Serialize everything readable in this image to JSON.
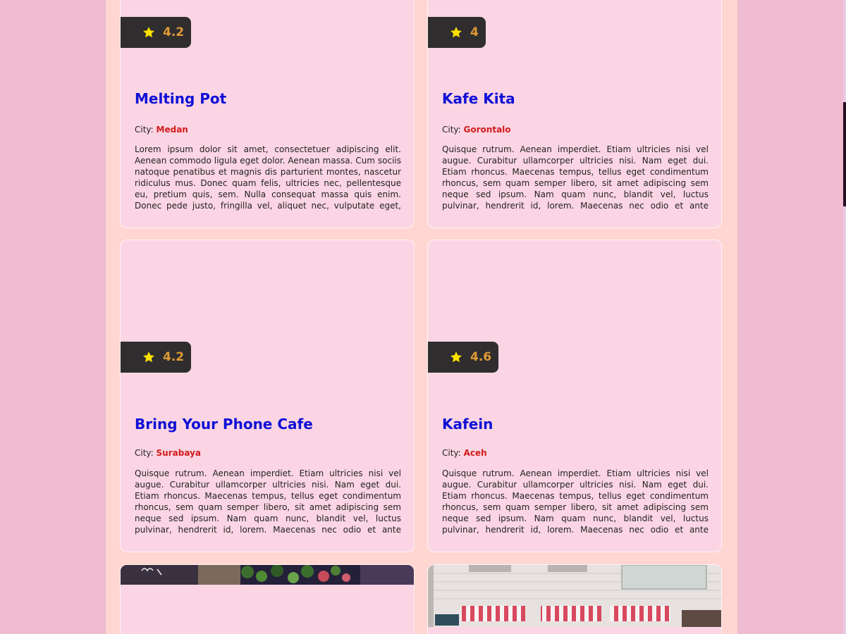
{
  "colors": {
    "page_background": "#efbcd1",
    "content_background": "#ffd6d1",
    "card_background": "#fbd5e4",
    "title_color": "#1010d6",
    "city_color": "#d11b1b",
    "rating_color": "#e09a35",
    "badge_background": "#2f2d2e",
    "star_color": "#ffe100"
  },
  "cards": [
    {
      "name": "Melting Pot",
      "rating": "4.2",
      "city_label": "City:",
      "city": "Medan",
      "description": "Lorem ipsum dolor sit amet, consectetuer adipiscing elit. Aenean commodo ligula eget dolor. Aenean massa. Cum sociis natoque penatibus et magnis dis parturient montes, nascetur ridiculus mus. Donec quam felis, ultricies nec, pellentesque eu, pretium quis, sem. Nulla consequat massa quis enim. Donec pede justo, fringilla vel, aliquet nec, vulputate eget, arcu. In enim justo, rhoncus ut, imperdiet a, venenatis vitae, justo."
    },
    {
      "name": "Kafe Kita",
      "rating": "4",
      "city_label": "City:",
      "city": "Gorontalo",
      "description": "Quisque rutrum. Aenean imperdiet. Etiam ultricies nisi vel augue. Curabitur ullamcorper ultricies nisi. Nam eget dui. Etiam rhoncus. Maecenas tempus, tellus eget condimentum rhoncus, sem quam semper libero, sit amet adipiscing sem neque sed ipsum. Nam quam nunc, blandit vel, luctus pulvinar, hendrerit id, lorem. Maecenas nec odio et ante tincidunt tempus. Donec vitae sapien ut libero venenatis faucibus. Nullam quis ante."
    },
    {
      "name": "Bring Your Phone Cafe",
      "rating": "4.2",
      "city_label": "City:",
      "city": "Surabaya",
      "description": "Quisque rutrum. Aenean imperdiet. Etiam ultricies nisi vel augue. Curabitur ullamcorper ultricies nisi. Nam eget dui. Etiam rhoncus. Maecenas tempus, tellus eget condimentum rhoncus, sem quam semper libero, sit amet adipiscing sem neque sed ipsum. Nam quam nunc, blandit vel, luctus pulvinar, hendrerit id, lorem. Maecenas nec odio et ante tincidunt tempus. Donec vitae sapien ut libero venenatis faucibus. Nullam quis ante."
    },
    {
      "name": "Kafein",
      "rating": "4.6",
      "city_label": "City:",
      "city": "Aceh",
      "description": "Quisque rutrum. Aenean imperdiet. Etiam ultricies nisi vel augue. Curabitur ullamcorper ultricies nisi. Nam eget dui. Etiam rhoncus. Maecenas tempus, tellus eget condimentum rhoncus, sem quam semper libero, sit amet adipiscing sem neque sed ipsum. Nam quam nunc, blandit vel, luctus pulvinar, hendrerit id, lorem. Maecenas nec odio et ante tincidunt tempus. Donec vitae sapien ut libero venenatis faucibus. Nullam quis ante."
    }
  ]
}
